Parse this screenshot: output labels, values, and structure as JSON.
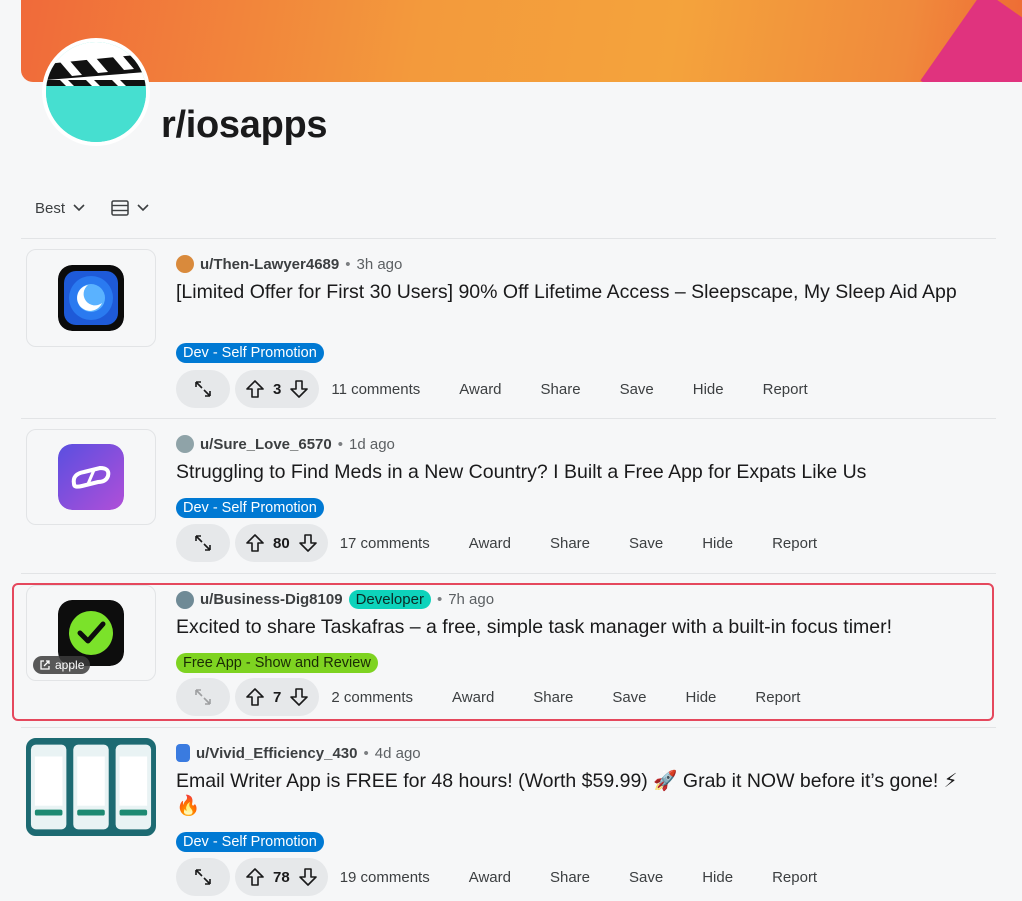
{
  "subreddit": {
    "name": "r/iosapps"
  },
  "sort": {
    "label": "Best"
  },
  "posts": [
    {
      "user": "u/Then-Lawyer4689",
      "time": "3h ago",
      "title": "[Limited Offer for First 30 Users] 90% Off Lifetime Access – Sleepscape, My Sleep Aid App",
      "flair": "Dev - Self Promotion",
      "votes": "3",
      "comments": "11 comments"
    },
    {
      "user": "u/Sure_Love_6570",
      "time": "1d ago",
      "title": "Struggling to Find Meds in a New Country? I Built a Free App for Expats Like Us",
      "flair": "Dev - Self Promotion",
      "votes": "80",
      "comments": "17 comments"
    },
    {
      "user": "u/Business-Dig8109",
      "user_flair": "Developer",
      "time": "7h ago",
      "title": "Excited to share Taskafras – a free, simple task manager with a built-in focus timer!",
      "flair": "Free App - Show and Review",
      "votes": "7",
      "comments": "2 comments",
      "link_label": "apple"
    },
    {
      "user": "u/Vivid_Efficiency_430",
      "time": "4d ago",
      "title": "Email Writer App is FREE for 48 hours! (Worth $59.99) 🚀 Grab it NOW before it’s gone! ⚡🔥",
      "flair": "Dev - Self Promotion",
      "votes": "78",
      "comments": "19 comments"
    }
  ],
  "actions": {
    "award": "Award",
    "share": "Share",
    "save": "Save",
    "hide": "Hide",
    "report": "Report"
  },
  "meta": {
    "separator": "•"
  },
  "icons": {
    "sort_chevron": "chevron-down-icon",
    "view": "card-view-icon",
    "expand": "expand-arrows-icon",
    "upvote": "upvote-arrow-icon",
    "downvote": "downvote-arrow-icon",
    "external": "external-link-icon"
  },
  "colors": {
    "flair_blue": "#0079d3",
    "flair_green": "#7ed321",
    "flair_teal": "#0dd3bb",
    "highlight": "#e5485d"
  }
}
